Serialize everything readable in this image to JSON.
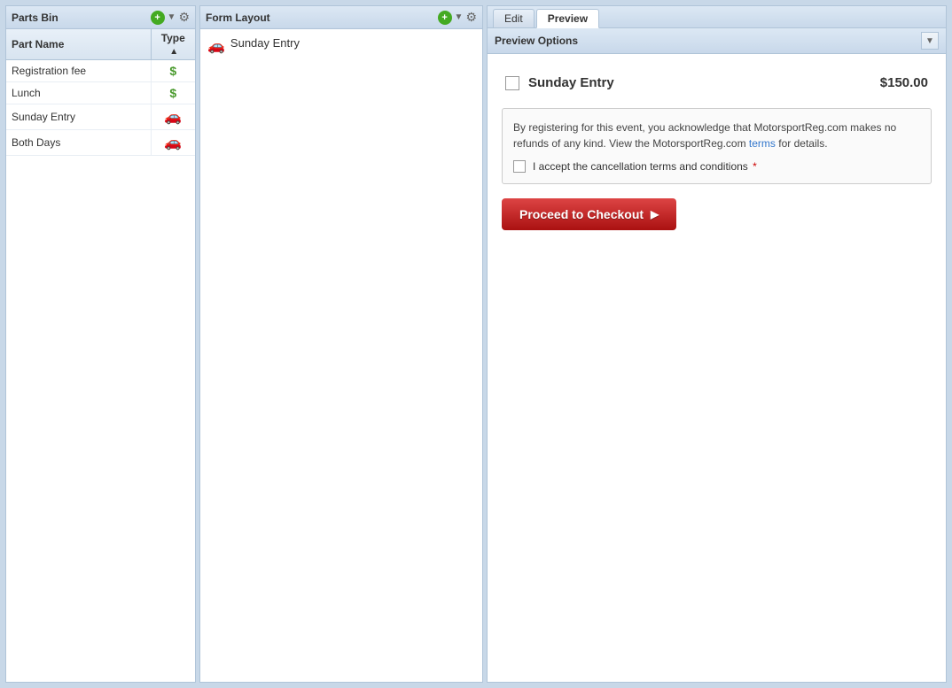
{
  "parts_bin": {
    "title": "Parts Bin",
    "columns": {
      "part_name": "Part Name",
      "type": "Type",
      "sort_arrow": "▲"
    },
    "items": [
      {
        "name": "Registration fee",
        "type": "dollar"
      },
      {
        "name": "Lunch",
        "type": "dollar"
      },
      {
        "name": "Sunday Entry",
        "type": "car"
      },
      {
        "name": "Both Days",
        "type": "car"
      }
    ]
  },
  "form_layout": {
    "title": "Form Layout",
    "item": {
      "label": "Sunday Entry",
      "icon": "car"
    }
  },
  "preview": {
    "tabs": [
      {
        "label": "Edit",
        "active": false
      },
      {
        "label": "Preview",
        "active": true
      }
    ],
    "options_bar": {
      "label": "Preview Options",
      "toggle": "▼"
    },
    "entry": {
      "name": "Sunday Entry",
      "price": "$150.00"
    },
    "terms": {
      "text_before_link": "By registering for this event, you acknowledge that MotorsportReg.com makes no refunds of any kind. View the MotorsportReg.com",
      "link_text": "terms",
      "text_after_link": "for details.",
      "accept_label": "I accept the cancellation terms and conditions",
      "required_marker": "*"
    },
    "checkout_button": "Proceed to Checkout"
  }
}
